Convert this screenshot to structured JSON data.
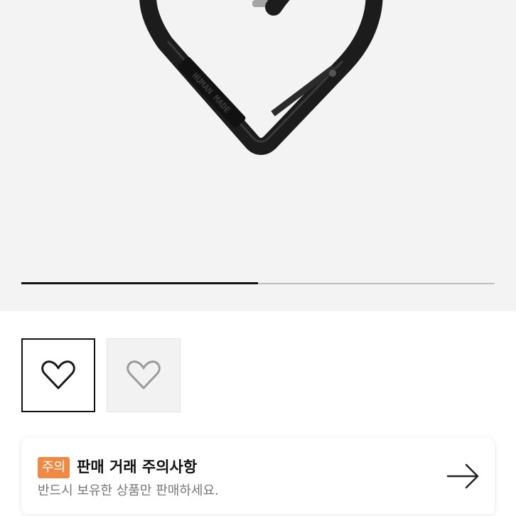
{
  "product": {
    "image_icon": "heart-carabiner-image",
    "engraved_text": "HUMAN MADE",
    "gallery_progress": 0.5
  },
  "thumbnails": [
    {
      "icon": "black-heart-carabiner",
      "selected": true
    },
    {
      "icon": "silver-heart-carabiner",
      "selected": false
    }
  ],
  "notice": {
    "badge": "주의",
    "title": "판매 거래 주의사항",
    "description": "반드시 보유한 상품만 판매하세요.",
    "arrow_icon": "arrow-right-icon",
    "badge_color": "#ee8a43"
  }
}
